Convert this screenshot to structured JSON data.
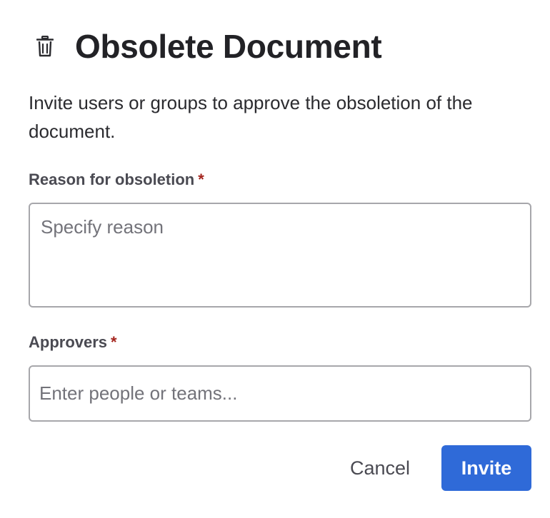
{
  "dialog": {
    "title": "Obsolete Document",
    "icon": "trash-icon",
    "description": "Invite users or groups to approve the obsoletion of the document.",
    "reason": {
      "label": "Reason for obsoletion",
      "required_mark": "*",
      "value": "",
      "placeholder": "Specify reason"
    },
    "approvers": {
      "label": "Approvers",
      "required_mark": "*",
      "value": "",
      "placeholder": "Enter people or teams..."
    },
    "actions": {
      "cancel_label": "Cancel",
      "invite_label": "Invite"
    }
  },
  "colors": {
    "primary": "#2f6ad8",
    "required": "#a4241d",
    "border": "#a7a7ab"
  }
}
